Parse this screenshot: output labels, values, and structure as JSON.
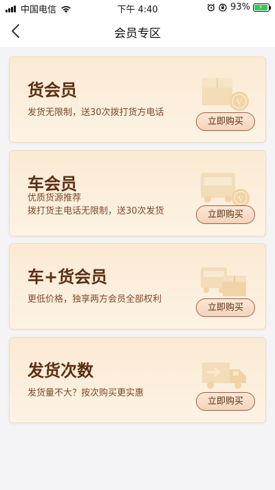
{
  "status_bar": {
    "carrier": "中国电信",
    "time": "下午 4:40",
    "battery_percent": "93%",
    "battery_level": 0.93
  },
  "nav": {
    "title": "会员专区"
  },
  "cards": [
    {
      "title": "货会员",
      "desc_lines": [
        "发货无限制，送30次拨打货方电话"
      ],
      "button": "立即购买",
      "icon": "cargo-box-v-icon"
    },
    {
      "title": "车会员",
      "desc_lines": [
        "优质货源推荐",
        "拨打货主电话无限制，送30次发货"
      ],
      "button": "立即购买",
      "icon": "truck-v-icon"
    },
    {
      "title": "车+货会员",
      "desc_lines": [
        "更低价格，独享两方会员全部权利"
      ],
      "button": "立即购买",
      "icon": "truck-cargo-icon"
    },
    {
      "title": "发货次数",
      "desc_lines": [
        "发货量不大？按次购买更实惠"
      ],
      "button": "立即购买",
      "icon": "delivery-truck-icon"
    }
  ],
  "colors": {
    "card_bg": "#fbead3",
    "title": "#5b2e12",
    "desc": "#7a4a2a",
    "illustration": "#f1d3a6"
  }
}
